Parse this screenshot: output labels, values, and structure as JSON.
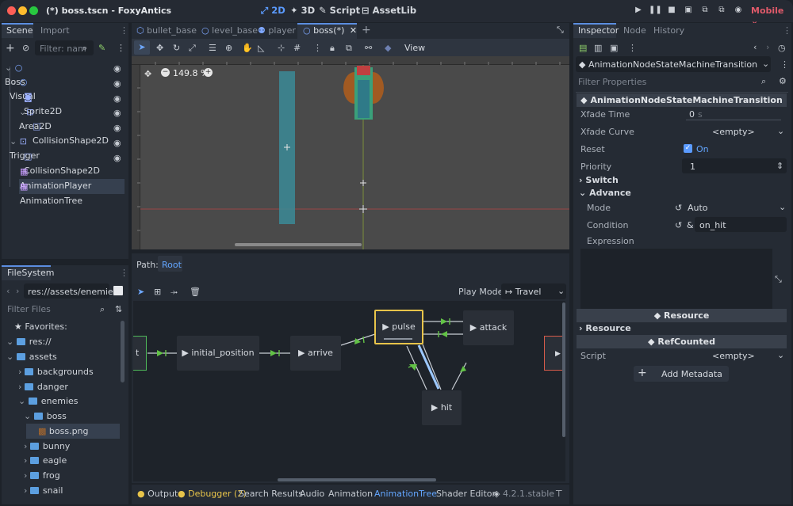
{
  "window": {
    "title": "(*) boss.tscn - FoxyAntics"
  },
  "workspaces": [
    {
      "label": "2D",
      "icon": "2d-icon",
      "active": true
    },
    {
      "label": "3D",
      "icon": "3d-icon",
      "active": false
    },
    {
      "label": "Script",
      "icon": "script-icon",
      "active": false
    },
    {
      "label": "AssetLib",
      "icon": "assetlib-icon",
      "active": false
    }
  ],
  "renderer": "Mobile",
  "scene_dock": {
    "tabs": [
      "Scene",
      "Import"
    ],
    "filter_placeholder": "Filter: nam",
    "tree": [
      {
        "label": "Boss",
        "icon": "node2d-icon",
        "eye": true
      },
      {
        "label": "Visual",
        "icon": "node2d-icon",
        "eye": true
      },
      {
        "label": "Sprite2D",
        "icon": "sprite2d-icon",
        "eye": true
      },
      {
        "label": "Area2D",
        "icon": "area2d-icon",
        "eye": true
      },
      {
        "label": "CollisionShape2D",
        "icon": "collisionshape2d-icon",
        "eye": true
      },
      {
        "label": "Trigger",
        "icon": "area2d-icon",
        "eye": true
      },
      {
        "label": "CollisionShape2D",
        "icon": "collisionshape2d-icon",
        "eye": true
      },
      {
        "label": "AnimationPlayer",
        "icon": "animationplayer-icon",
        "eye": false
      },
      {
        "label": "AnimationTree",
        "icon": "animationtree-icon",
        "eye": false
      }
    ]
  },
  "filesystem": {
    "tab": "FileSystem",
    "path": "res://assets/enemies/",
    "filter_placeholder": "Filter Files",
    "items": [
      {
        "label": "Favorites:",
        "icon": "star-icon"
      },
      {
        "label": "res://",
        "icon": "folder-icon"
      },
      {
        "label": "assets",
        "icon": "folder-icon"
      },
      {
        "label": "backgrounds",
        "icon": "folder-icon"
      },
      {
        "label": "danger",
        "icon": "folder-icon"
      },
      {
        "label": "enemies",
        "icon": "folder-icon"
      },
      {
        "label": "boss",
        "icon": "folder-icon"
      },
      {
        "label": "boss.png",
        "icon": "image-icon"
      },
      {
        "label": "bunny",
        "icon": "folder-icon"
      },
      {
        "label": "eagle",
        "icon": "folder-icon"
      },
      {
        "label": "frog",
        "icon": "folder-icon"
      },
      {
        "label": "snail",
        "icon": "folder-icon"
      }
    ]
  },
  "scene_tabs": [
    "bullet_base",
    "level_base",
    "player",
    "boss(*)"
  ],
  "toolbar": {
    "view_label": "View",
    "zoom": "149.8 %"
  },
  "anim_tree": {
    "path_label": "Path:",
    "path_value": "Root",
    "play_mode_label": "Play Mode:",
    "play_mode_value": "Travel",
    "nodes": [
      "t",
      "initial_position",
      "arrive",
      "pulse",
      "attack",
      "hit",
      "E"
    ]
  },
  "bottom_tabs": [
    {
      "label": "Output",
      "dot": "#e8c44a"
    },
    {
      "label": "Debugger (2)",
      "dot": "#e8c44a"
    },
    {
      "label": "Search Results",
      "dot": ""
    },
    {
      "label": "Audio",
      "dot": ""
    },
    {
      "label": "Animation",
      "dot": ""
    },
    {
      "label": "AnimationTree",
      "dot": ""
    },
    {
      "label": "Shader Editor",
      "dot": ""
    }
  ],
  "version": "4.2.1.stable",
  "inspector": {
    "tabs": [
      "Inspector",
      "Node",
      "History"
    ],
    "object": "AnimationNodeStateMachineTransition",
    "filter_placeholder": "Filter Properties",
    "class_header": "AnimationNodeStateMachineTransition",
    "xfade_time_label": "Xfade Time",
    "xfade_time_value": "0",
    "xfade_time_unit": "s",
    "xfade_curve_label": "Xfade Curve",
    "xfade_curve_value": "<empty>",
    "reset_label": "Reset",
    "reset_value": "On",
    "priority_label": "Priority",
    "priority_value": "1",
    "switch_label": "Switch",
    "advance_label": "Advance",
    "mode_label": "Mode",
    "mode_value": "Auto",
    "condition_label": "Condition",
    "condition_value": "on_hit",
    "condition_prefix": "&",
    "expression_label": "Expression",
    "resource_header": "Resource",
    "resource_label": "Resource",
    "refcounted_header": "RefCounted",
    "script_label": "Script",
    "script_value": "<empty>",
    "add_metadata": "Add Metadata"
  },
  "colors": {
    "accent": "#5b8de0",
    "active_text": "#63a6ff",
    "pulse_border": "#e8c44a",
    "green_arrow": "#62c246"
  }
}
